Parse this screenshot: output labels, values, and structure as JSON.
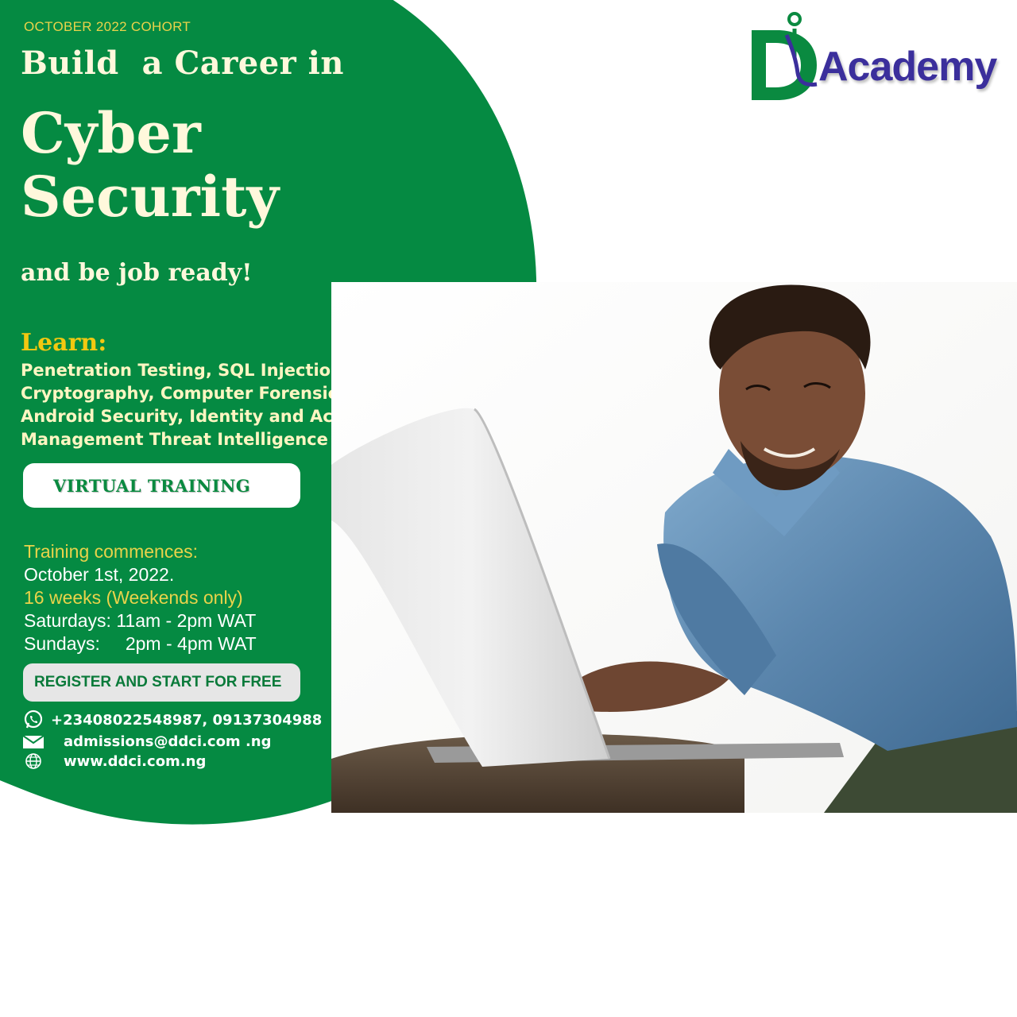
{
  "header": {
    "cohort": "OCTOBER 2022 COHORT",
    "headline_line1": "Build  a Career in",
    "headline_line2": "Cyber",
    "headline_line3": "Security",
    "headline_line4": "and be job ready!"
  },
  "learn": {
    "heading": "Learn:",
    "topics": "Penetration Testing, SQL Injection, Cryptography, Computer Forensics, Android Security, Identity and Access Management Threat Intelligence"
  },
  "mode_button": {
    "label": "VIRTUAL TRAINING"
  },
  "schedule": {
    "commences_label": "Training commences:",
    "start_date": "October 1st, 2022.",
    "duration": "16 weeks (Weekends only)",
    "saturdays": "Saturdays: 11am - 2pm WAT",
    "sundays": "Sundays:     2pm - 4pm WAT"
  },
  "register_button": {
    "label": "REGISTER AND START FOR FREE"
  },
  "contact": {
    "phone": "+23408022548987, 09137304988",
    "email": "admissions@ddci.com .ng",
    "website": "www.ddci.com.ng"
  },
  "logo": {
    "text": "Academy"
  },
  "colors": {
    "brand_green": "#058a42",
    "accent_yellow": "#f2c811",
    "logo_blue": "#3b2f9c",
    "cream": "#fff8dc"
  },
  "icons": [
    "whatsapp-icon",
    "mail-icon",
    "globe-icon"
  ]
}
